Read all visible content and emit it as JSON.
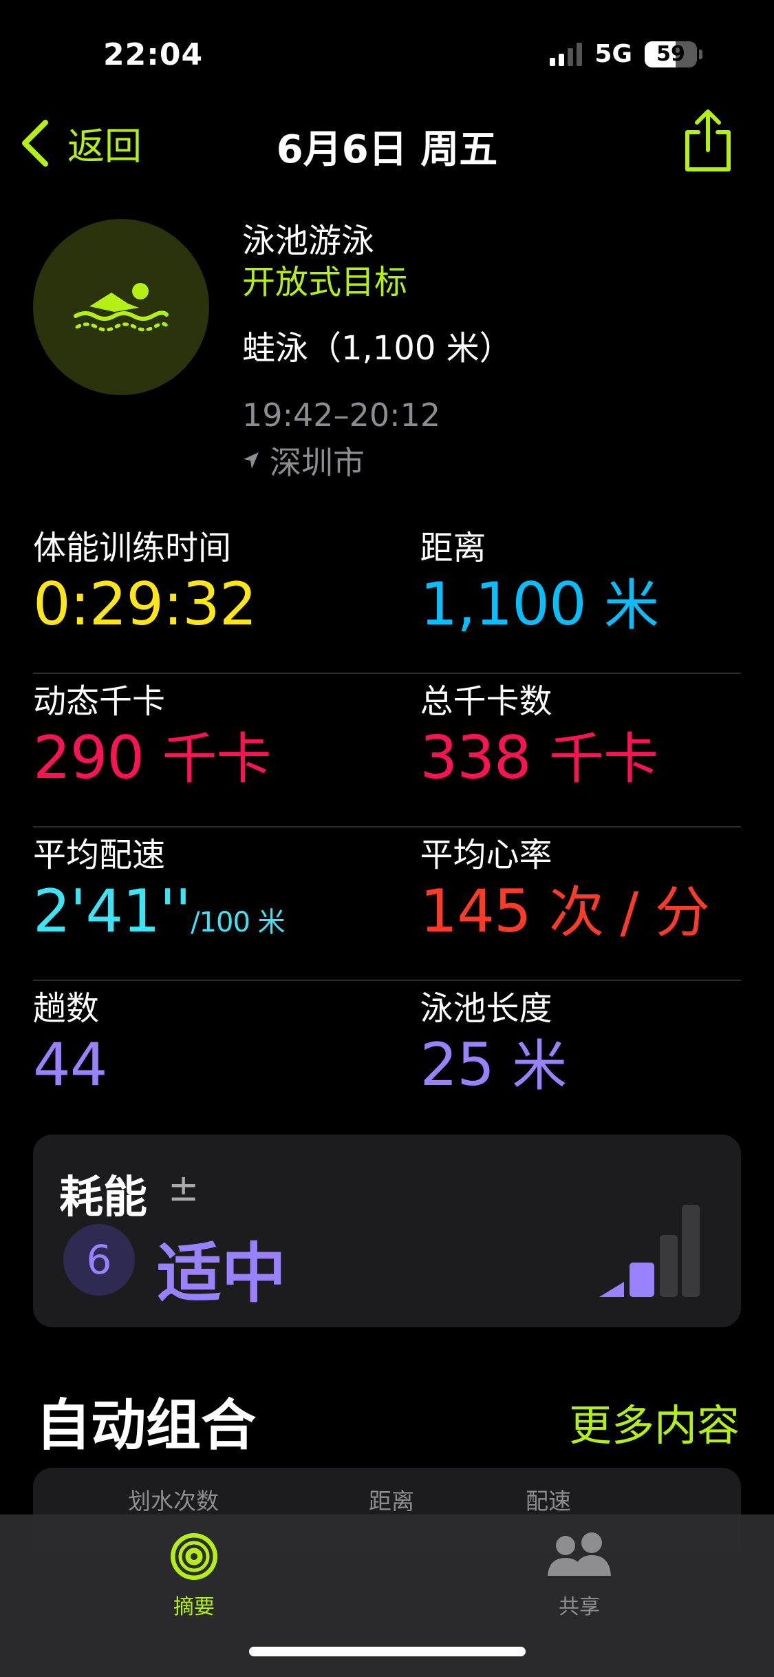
{
  "status": {
    "time": "22:04",
    "network": "5G",
    "battery": "59"
  },
  "nav": {
    "back_label": "返回",
    "title": "6月6日 周五"
  },
  "workout": {
    "type": "泳池游泳",
    "goal": "开放式目标",
    "stroke": "蛙泳（1,100 米）",
    "time_range": "19:42–20:12",
    "location": "深圳市"
  },
  "metrics": {
    "workout_time": {
      "label": "体能训练时间",
      "value": "0:29:32"
    },
    "distance": {
      "label": "距离",
      "value": "1,100",
      "unit": "米"
    },
    "active_kcal": {
      "label": "动态千卡",
      "value": "290",
      "unit": "千卡"
    },
    "total_kcal": {
      "label": "总千卡数",
      "value": "338",
      "unit": "千卡"
    },
    "avg_pace": {
      "label": "平均配速",
      "value": "2'41''",
      "unit": "/100 米"
    },
    "avg_hr": {
      "label": "平均心率",
      "value": "145",
      "unit": "次 / 分"
    },
    "laps": {
      "label": "趟数",
      "value": "44"
    },
    "pool_length": {
      "label": "泳池长度",
      "value": "25",
      "unit": "米"
    }
  },
  "effort": {
    "title": "耗能",
    "adjust_icon": "±",
    "score": "6",
    "level": "适中",
    "level_fraction": 0.5
  },
  "auto_sets": {
    "title": "自动组合",
    "more": "更多内容",
    "columns": [
      "划水次数",
      "距离",
      "配速"
    ]
  },
  "tabs": [
    {
      "label": "摘要",
      "icon": "activity-rings-icon",
      "active": true
    },
    {
      "label": "共享",
      "icon": "people-icon",
      "active": false
    }
  ],
  "colors": {
    "accent": "#b4f014",
    "time": "#ffe619",
    "distance": "#0abdfb",
    "calories": "#fa1454",
    "pace": "#3ee4f4",
    "heart": "#fd3b29",
    "laps": "#9a82ff"
  }
}
